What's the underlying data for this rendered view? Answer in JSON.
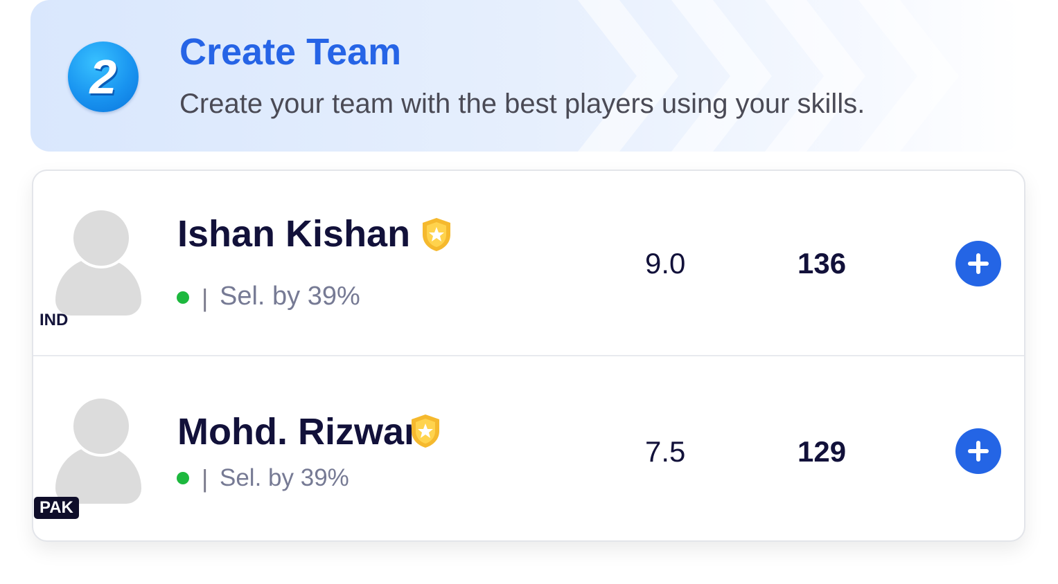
{
  "step": {
    "number": "2",
    "title": "Create Team",
    "description": "Create your team with the best players using your skills."
  },
  "players": [
    {
      "name": "Ishan Kishan",
      "country": "IND",
      "selected": "Sel. by 39%",
      "separator": "|",
      "credits": "9.0",
      "points": "136",
      "status_color": "#1db83e"
    },
    {
      "name": "Mohd. Rizwan",
      "country": "PAK",
      "selected": "Sel. by 39%",
      "separator": "|",
      "credits": "7.5",
      "points": "129",
      "status_color": "#1db83e"
    }
  ],
  "icons": {
    "step_badge": "step-number-badge",
    "player_badge": "shield-star-icon",
    "avatar": "avatar-placeholder-icon",
    "add": "plus-icon"
  },
  "colors": {
    "accent": "#2664e6",
    "add_button": "#2465e5",
    "text_dark": "#12113a",
    "text_muted": "#767a94",
    "status_active": "#1db83e",
    "badge_gold": "#f5b92e"
  }
}
